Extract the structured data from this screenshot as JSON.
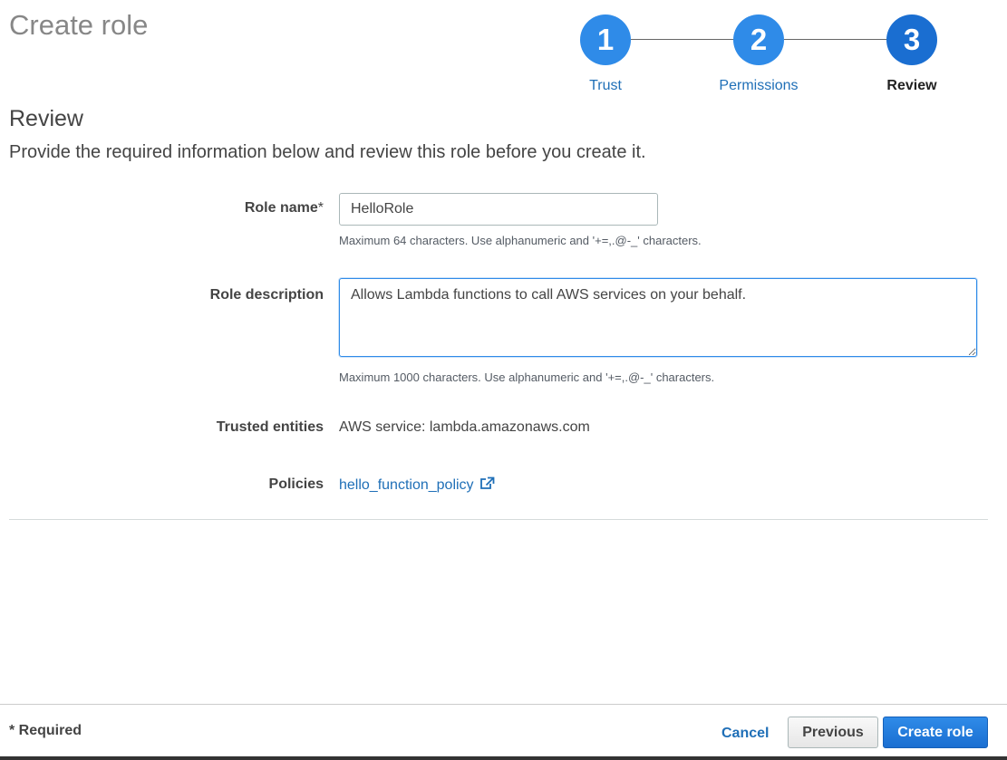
{
  "page": {
    "title": "Create role"
  },
  "stepper": {
    "steps": [
      {
        "number": "1",
        "label": "Trust"
      },
      {
        "number": "2",
        "label": "Permissions"
      },
      {
        "number": "3",
        "label": "Review"
      }
    ],
    "active_step": 3
  },
  "review": {
    "heading": "Review",
    "description": "Provide the required information below and review this role before you create it."
  },
  "form": {
    "role_name": {
      "label": "Role name",
      "required_mark": "*",
      "value": "HelloRole",
      "hint": "Maximum 64 characters. Use alphanumeric and '+=,.@-_' characters."
    },
    "role_description": {
      "label": "Role description",
      "value": "Allows Lambda functions to call AWS services on your behalf.",
      "hint": "Maximum 1000 characters. Use alphanumeric and '+=,.@-_' characters."
    },
    "trusted_entities": {
      "label": "Trusted entities",
      "value": "AWS service: lambda.amazonaws.com"
    },
    "policies": {
      "label": "Policies",
      "link_text": "hello_function_policy",
      "icon": "external-link-icon"
    }
  },
  "footer": {
    "required_note": "* Required",
    "cancel_label": "Cancel",
    "previous_label": "Previous",
    "create_label": "Create role"
  },
  "colors": {
    "accent": "#2f8be8",
    "accent_dark": "#1a6ed1",
    "link": "#1f6fb7",
    "title_gray": "#878787"
  }
}
